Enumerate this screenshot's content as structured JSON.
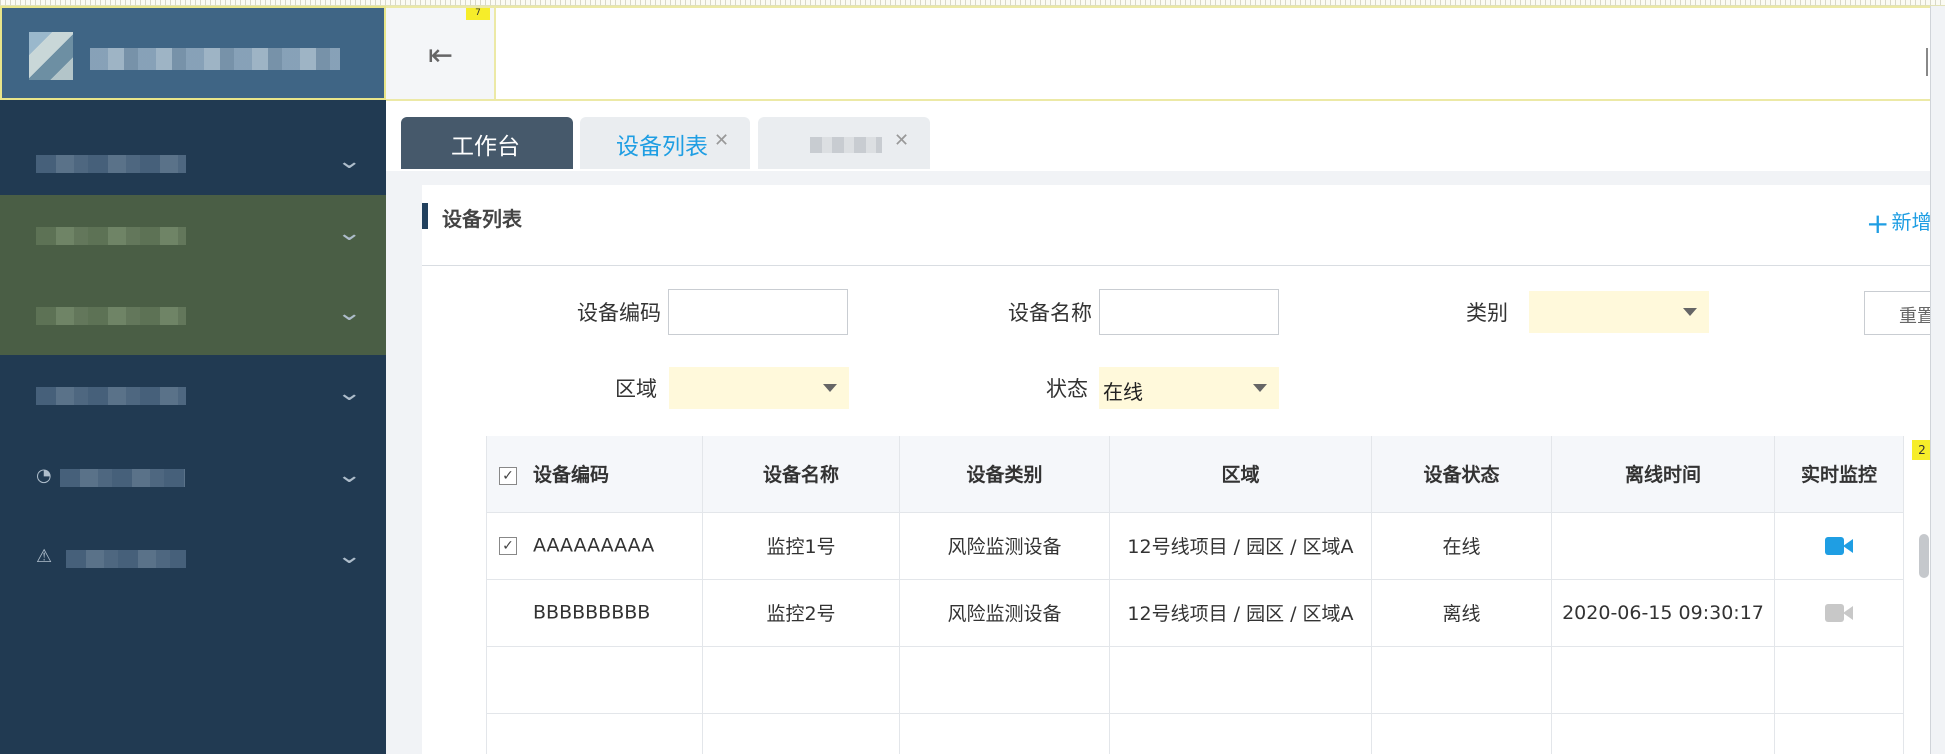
{
  "sidebar": {
    "menu_items": [
      {
        "id": "menu-1",
        "highlighted": false,
        "icon": ""
      },
      {
        "id": "menu-2",
        "highlighted": true,
        "icon": ""
      },
      {
        "id": "menu-3",
        "highlighted": true,
        "icon": ""
      },
      {
        "id": "menu-4",
        "highlighted": false,
        "icon": ""
      },
      {
        "id": "menu-5",
        "highlighted": false,
        "icon": "circle-icon"
      },
      {
        "id": "menu-6",
        "highlighted": false,
        "icon": "warning-icon"
      }
    ]
  },
  "header": {
    "menu_toggle_icon": "menu-fold-icon",
    "tag_label": "7"
  },
  "tabs": [
    {
      "label": "工作台",
      "active": true
    },
    {
      "label": "设备列表",
      "active": false,
      "closable": true
    },
    {
      "label": "",
      "active": false,
      "closable": true
    }
  ],
  "page": {
    "title": "设备列表",
    "add_label": "新增",
    "reset_label": "重置"
  },
  "filters": {
    "code_label": "设备编码",
    "code_value": "",
    "name_label": "设备名称",
    "name_value": "",
    "category_label": "类别",
    "category_value": "",
    "area_label": "区域",
    "area_value": "",
    "status_label": "状态",
    "status_value": "在线"
  },
  "table": {
    "columns": [
      "设备编码",
      "设备名称",
      "设备类别",
      "区域",
      "设备状态",
      "离线时间",
      "实时监控"
    ],
    "rows": [
      {
        "checked": true,
        "code": "AAAAAAAAA",
        "name": "监控1号",
        "category": "风险监测设备",
        "area": "12号线项目 / 园区 / 区域A",
        "status": "在线",
        "offline_time": "",
        "monitor_icon": "video-camera-icon",
        "monitor_active": true
      },
      {
        "checked": false,
        "code": "BBBBBBBBB",
        "name": "监控2号",
        "category": "风险监测设备",
        "area": "12号线项目 / 园区 / 区域A",
        "status": "离线",
        "offline_time": "2020-06-15 09:30:17",
        "monitor_icon": "video-camera-icon",
        "monitor_active": false
      }
    ],
    "badge": "2",
    "colors": {
      "active": "#1f9ee3",
      "inactive": "#c8c8c8"
    }
  }
}
